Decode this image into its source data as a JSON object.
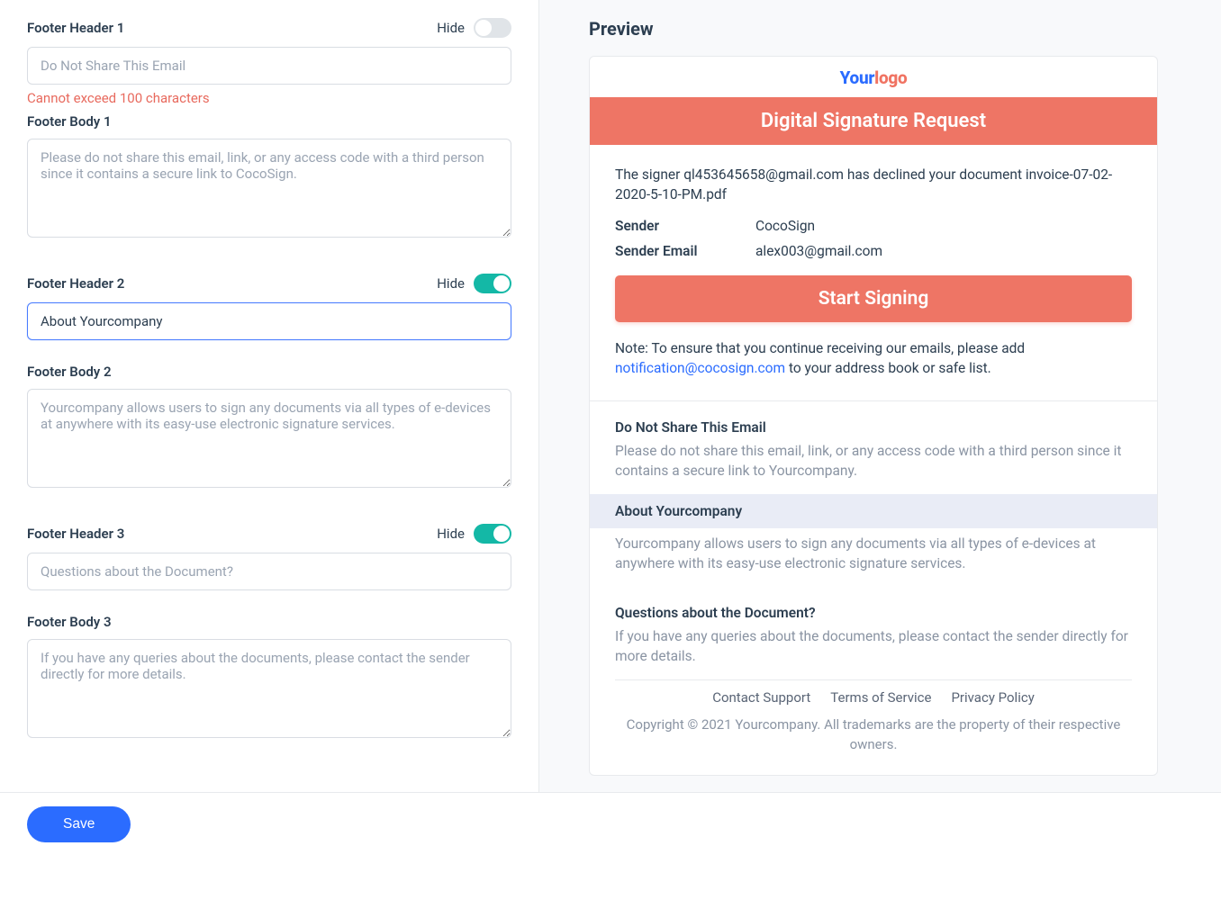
{
  "form": {
    "hideLabel": "Hide",
    "footerHeader1": {
      "label": "Footer Header 1",
      "placeholder": "Do Not Share This Email",
      "value": "",
      "error": "Cannot exceed 100 characters"
    },
    "footerBody1": {
      "label": "Footer Body 1",
      "placeholder": "Please do not share this email, link, or any access code with a third person since it contains a secure link to CocoSign.",
      "value": ""
    },
    "footerHeader2": {
      "label": "Footer Header 2",
      "value": "About Yourcompany"
    },
    "footerBody2": {
      "label": "Footer Body 2",
      "placeholder": "Yourcompany allows users to sign any documents via all types of e-devices at anywhere with its easy-use electronic signature services.",
      "value": ""
    },
    "footerHeader3": {
      "label": "Footer Header 3",
      "placeholder": "Questions about the Document?",
      "value": ""
    },
    "footerBody3": {
      "label": "Footer Body 3",
      "placeholder": "If you have any queries about the documents, please contact the sender directly for more details.",
      "value": ""
    },
    "saveLabel": "Save"
  },
  "preview": {
    "title": "Preview",
    "logoPart1": "Your",
    "logoPart2": "logo",
    "banner": "Digital Signature Request",
    "declineText": "The signer ql453645658@gmail.com has declined your document invoice-07-02-2020-5-10-PM.pdf",
    "senderLabel": "Sender",
    "senderValue": "CocoSign",
    "senderEmailLabel": "Sender Email",
    "senderEmailValue": "alex003@gmail.com",
    "startSigning": "Start Signing",
    "notePrefix": "Note: To ensure that you continue receiving our emails, please add ",
    "noteEmail": "notification@cocosign.com",
    "noteSuffix": " to your address book or safe list.",
    "section1Head": "Do Not Share This Email",
    "section1Body": "Please do not share this email, link, or any access code with a third person since it contains a secure link to Yourcompany.",
    "section2Head": "About Yourcompany",
    "section2Body": "Yourcompany allows users to sign any documents via all types of e-devices at anywhere with its easy-use electronic signature services.",
    "section3Head": "Questions about the Document?",
    "section3Body": "If you have any queries about the documents, please contact the sender directly for more details.",
    "footerLinks": {
      "contactSupport": "Contact Support",
      "terms": "Terms of Service",
      "privacy": "Privacy Policy"
    },
    "copyright": "Copyright © 2021 Yourcompany. All trademarks are the property of their respective owners."
  }
}
